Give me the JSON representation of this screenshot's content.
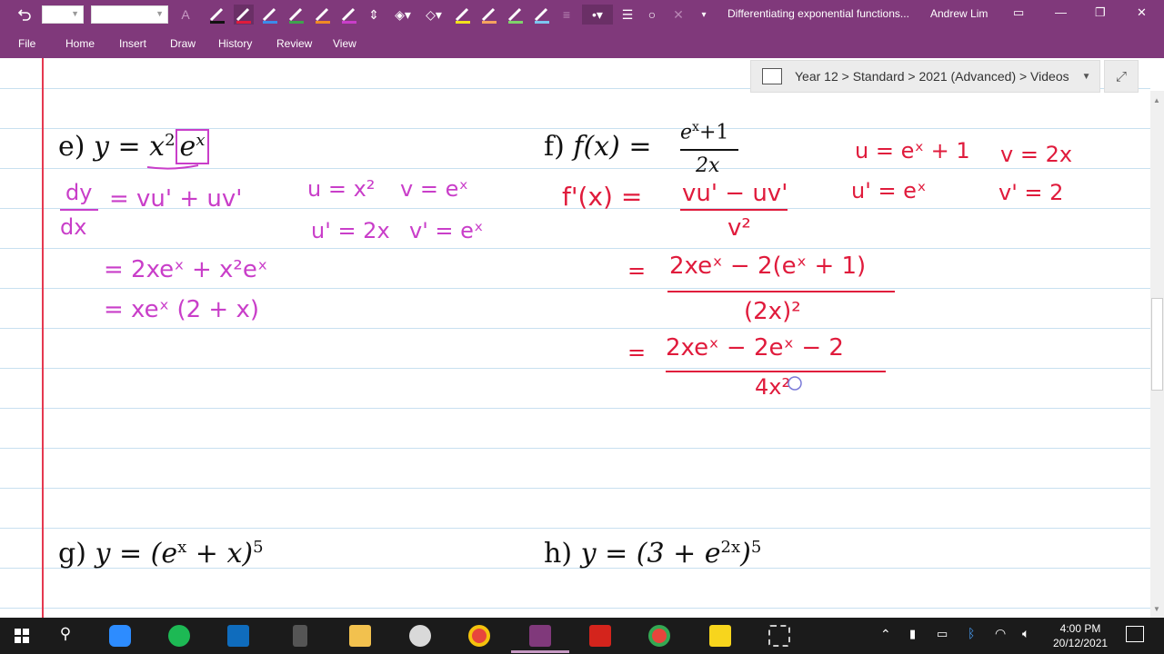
{
  "app": {
    "document_title": "Differentiating exponential functions...",
    "user_name": "Andrew Lim",
    "font_name_value": "",
    "font_size_value": "",
    "accent": "#80397b"
  },
  "menu": [
    "File",
    "Home",
    "Insert",
    "Draw",
    "History",
    "Review",
    "View"
  ],
  "breadcrumb": {
    "path": "Year 12 > Standard > 2021 (Advanced) > Videos"
  },
  "notebook": {
    "typed": {
      "e_label": "e)",
      "e_expr_lhs": "y = x",
      "e_expr_sup": "2",
      "e_expr_box": "e",
      "e_expr_box_sup": "x",
      "f_label": "f)",
      "f_lhs": "f(x) =",
      "f_num": "e",
      "f_num_sup": "x",
      "f_num_rest": "+1",
      "f_den": "2x",
      "g_label": "g)",
      "g_expr": "y = (e",
      "g_sup1": "x",
      "g_mid": " + x)",
      "g_sup2": "5",
      "h_label": "h)",
      "h_expr": "y = (3 + e",
      "h_sup1": "2x",
      "h_mid": ")",
      "h_sup2": "5"
    },
    "ink_e": {
      "dy": "dy",
      "dx": "dx",
      "eq1": "= vu' + uv'",
      "u": "u = x²",
      "v": "v = eˣ",
      "du": "u' = 2x",
      "dv": "v' = eˣ",
      "line2": "= 2xeˣ + x²eˣ",
      "line3": "= xeˣ (2 + x)"
    },
    "ink_f": {
      "fprime": "f'(x) =",
      "num1": "vu' − uv'",
      "den1": "v²",
      "u": "u = eˣ + 1",
      "v": "v = 2x",
      "du": "u' = eˣ",
      "dv": "v' = 2",
      "eq2": "=",
      "num2": "2xeˣ − 2(eˣ + 1)",
      "den2": "(2x)²",
      "eq3": "=",
      "num3": "2xeˣ − 2eˣ − 2",
      "den3": "4x²"
    },
    "ink_colors": {
      "magenta": "#c93ec9",
      "red": "#e01b3c"
    }
  },
  "taskbar": {
    "time": "4:00 PM",
    "date": "20/12/2021"
  }
}
